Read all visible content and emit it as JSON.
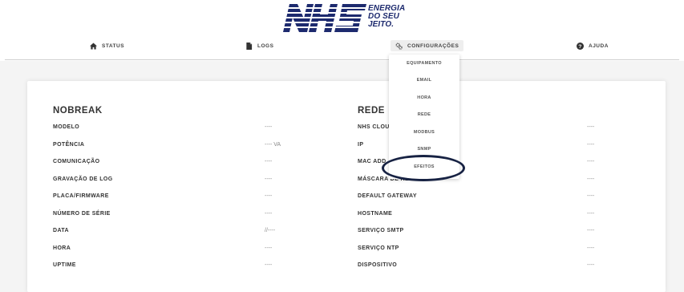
{
  "logo": {
    "brand": "NHS",
    "tagline": [
      "ENERGIA",
      "DO SEU",
      "JEITO."
    ],
    "brand_color": "#1d2a6e"
  },
  "nav": {
    "items": [
      {
        "label": "STATUS",
        "icon": "home-icon"
      },
      {
        "label": "LOGS",
        "icon": "document-icon"
      },
      {
        "label": "CONFIGURAÇÕES",
        "icon": "gears-icon"
      },
      {
        "label": "AJUDA",
        "icon": "help-circle-icon"
      }
    ],
    "active": "CONFIGURAÇÕES"
  },
  "dropdown": {
    "items": [
      "EQUIPAMENTO",
      "EMAIL",
      "HORA",
      "REDE",
      "MODBUS",
      "SNMP",
      "EFEITOS"
    ],
    "highlighted": "EFEITOS",
    "highlight_color": "#172243"
  },
  "nobreak": {
    "title": "NOBREAK",
    "rows": [
      {
        "label": "MODELO",
        "value": "----"
      },
      {
        "label": "POTÊNCIA",
        "value": "---- VA"
      },
      {
        "label": "COMUNICAÇÃO",
        "value": "----"
      },
      {
        "label": "GRAVAÇÃO DE LOG",
        "value": "----"
      },
      {
        "label": "PLACA/FIRMWARE",
        "value": "----"
      },
      {
        "label": "NÚMERO DE SÉRIE",
        "value": "----"
      },
      {
        "label": "DATA",
        "value": "//----"
      },
      {
        "label": "HORA",
        "value": "----"
      },
      {
        "label": "UPTIME",
        "value": "----"
      }
    ]
  },
  "rede": {
    "title": "REDE",
    "rows": [
      {
        "label": "NHS CLOU",
        "value": "----"
      },
      {
        "label": "IP",
        "value": "----"
      },
      {
        "label": "MAC ADD",
        "value": "----"
      },
      {
        "label": "MÁSCARA DE REDE",
        "value": "----"
      },
      {
        "label": "DEFAULT GATEWAY",
        "value": "----"
      },
      {
        "label": "HOSTNAME",
        "value": "----"
      },
      {
        "label": "SERVIÇO SMTP",
        "value": "----"
      },
      {
        "label": "SERVIÇO NTP",
        "value": "----"
      },
      {
        "label": "DISPOSITIVO",
        "value": "----"
      }
    ]
  }
}
